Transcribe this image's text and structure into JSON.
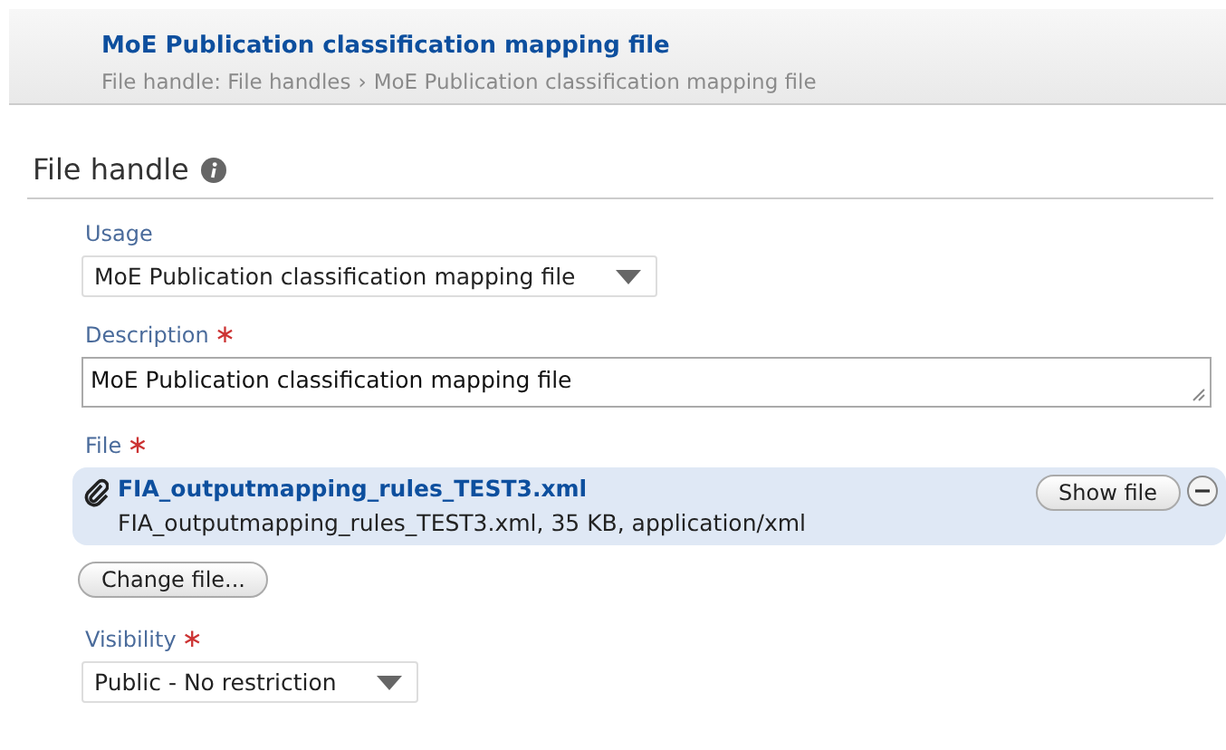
{
  "header": {
    "title": "MoE Publication classification mapping file",
    "breadcrumb": [
      {
        "label": "File handle: File handles"
      },
      {
        "label": "MoE Publication classification mapping file"
      }
    ],
    "breadcrumb_separator": "›"
  },
  "section": {
    "title": "File handle",
    "info_icon": true
  },
  "fields": [
    {
      "kind": "select",
      "label": "Usage",
      "value": "MoE Publication classification mapping file"
    },
    {
      "kind": "textarea",
      "label": "Description",
      "required_mark": "∗",
      "value": "MoE Publication classification mapping file"
    },
    {
      "kind": "file",
      "label": "File",
      "required_mark": "∗",
      "file_name": "FIA_outputmapping_rules_TEST3.xml",
      "file_info": "FIA_outputmapping_rules_TEST3.xml, 35 KB, application/xml",
      "show_button": "Show file",
      "change_button": "Change file..."
    },
    {
      "kind": "select",
      "label": "Visibility",
      "required_mark": "∗",
      "value": "Public - No restriction"
    }
  ]
}
